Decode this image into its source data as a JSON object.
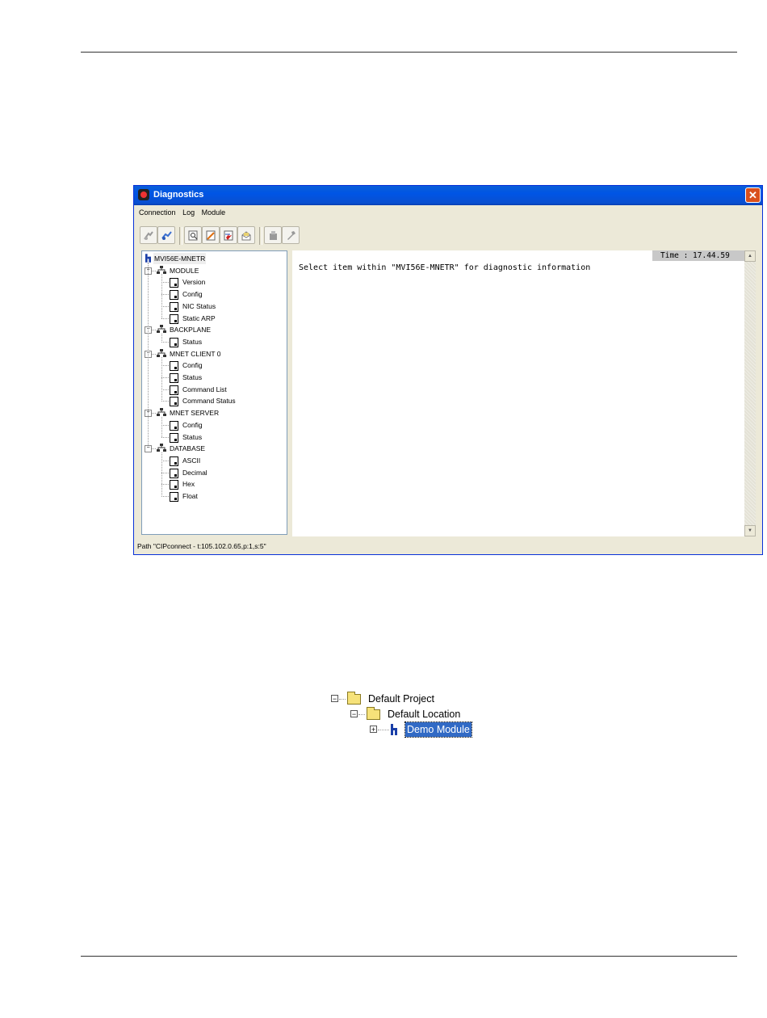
{
  "window": {
    "title": "Diagnostics",
    "close_glyph": "✕",
    "menu": [
      "Connection",
      "Log",
      "Module"
    ],
    "toolbar_icons": [
      "disconnect-icon",
      "connect-icon",
      "find-icon",
      "clear-log-icon",
      "capture-icon",
      "email-icon",
      "module-icon",
      "tool-icon"
    ],
    "tree": {
      "root": "MVI56E-MNETR",
      "groups": [
        {
          "label": "MODULE",
          "items": [
            "Version",
            "Config",
            "NIC Status",
            "Static ARP"
          ]
        },
        {
          "label": "BACKPLANE",
          "items": [
            "Status"
          ]
        },
        {
          "label": "MNET CLIENT 0",
          "items": [
            "Config",
            "Status",
            "Command List",
            "Command Status"
          ]
        },
        {
          "label": "MNET SERVER",
          "items": [
            "Config",
            "Status"
          ]
        },
        {
          "label": "DATABASE",
          "items": [
            "ASCII",
            "Decimal",
            "Hex",
            "Float"
          ]
        }
      ]
    },
    "message": "Select item within \"MVI56E-MNETR\" for diagnostic information",
    "time": "Time : 17.44.59",
    "status": "Path \"CIPconnect - t:105.102.0.65,p:1,s:5\""
  },
  "project_tree": {
    "project": "Default Project",
    "location": "Default Location",
    "module": "Demo Module"
  }
}
